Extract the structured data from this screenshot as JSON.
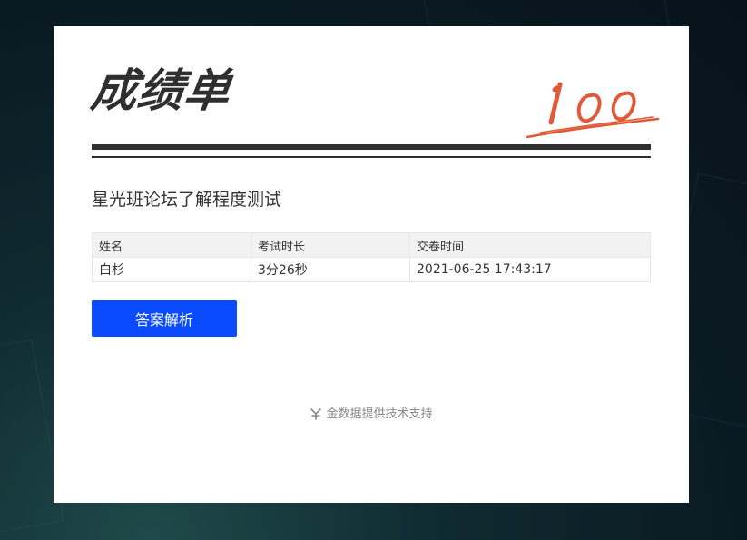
{
  "title": "成绩单",
  "stamp": {
    "text": "100",
    "color": "#e05a3a"
  },
  "exam": {
    "name": "星光班论坛了解程度测试"
  },
  "table": {
    "headers": [
      "姓名",
      "考试时长",
      "交卷时间"
    ],
    "rows": [
      {
        "name": "白杉",
        "duration": "3分26秒",
        "submit_time": "2021-06-25 17:43:17"
      }
    ]
  },
  "actions": {
    "answer_analysis_label": "答案解析"
  },
  "footer": {
    "text": "金数据提供技术支持",
    "icon": "jinshuju-logo-icon"
  },
  "colors": {
    "accent": "#0a4bff",
    "title": "#2f2f2f",
    "stamp": "#e05a3a",
    "table_header_bg": "#f2f2f2",
    "border": "#e6e6e6"
  }
}
